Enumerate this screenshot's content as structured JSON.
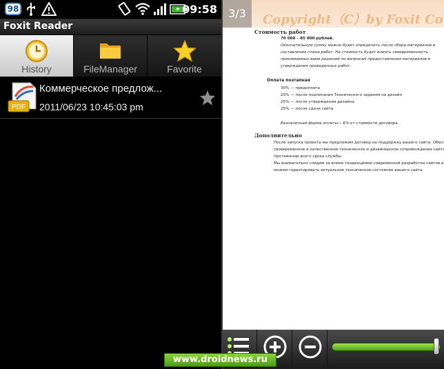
{
  "status_bar": {
    "badge": "98",
    "time": "09:58",
    "icons": [
      "usb-icon",
      "alert-icon",
      "vibrate-icon",
      "wifi-icon",
      "signal-icon",
      "battery-icon"
    ]
  },
  "app": {
    "title": "Foxit Reader"
  },
  "tabs": [
    {
      "label": "History",
      "icon": "clock-icon",
      "active": true
    },
    {
      "label": "FileManager",
      "icon": "folder-icon",
      "active": false
    },
    {
      "label": "Favorite",
      "icon": "star-icon",
      "active": false
    }
  ],
  "history": [
    {
      "name": "Коммерческое предлож...",
      "date": "2011/06/23 10:45:03 pm",
      "icon": "pdf-icon",
      "pdf_label": "PDF",
      "favorite_icon": "star-icon"
    }
  ],
  "viewer": {
    "page_indicator": "3/3",
    "watermark": "Copyright（C）by Foxit Corp"
  },
  "document": {
    "heading1": "Стоимость работ",
    "price": "70 000 – 85 000 рублей.",
    "lines1": [
      "Окончательную сумму можно будет определить после сбора материалов и",
      "составления плана работ. На стоимость будет влиять своевременность",
      "принимаемых вами решений по вопросам предоставления материалов и",
      "утверждения проведенных работ."
    ],
    "heading2": "Оплата поэтапная",
    "payments": [
      "30% — предоплата",
      "20% — после подписания Технического задания на дизайн",
      "25% — после утверждения дизайна",
      "25% — после сдачи сайта"
    ],
    "payment_note": "Безналичная форма оплаты— 6% от стоимости договора.",
    "heading3": "Дополнительно",
    "lines3": [
      "После запуска проекта мы предложим договор на поддержку вашего сайта. Обеспечим",
      "своевременное и качественное техническое и дизайнерское сопровождение сайта на",
      "протяжении всего срока службы.",
      "Мы внимательно следим за всеми тенденциями современной разработки сайтов и",
      "можем гарантировать актуальное техническое состояние вашего сайта."
    ]
  },
  "toolbar": {
    "buttons": [
      "list-icon",
      "zoom-in-icon",
      "zoom-out-icon"
    ],
    "zoom_level": 1.0
  },
  "credit": "www.droidnews.ru",
  "colors": {
    "accent_green": "#4fa41d",
    "watermark": "#f0b882",
    "tab_active": "#f2f2f2"
  }
}
